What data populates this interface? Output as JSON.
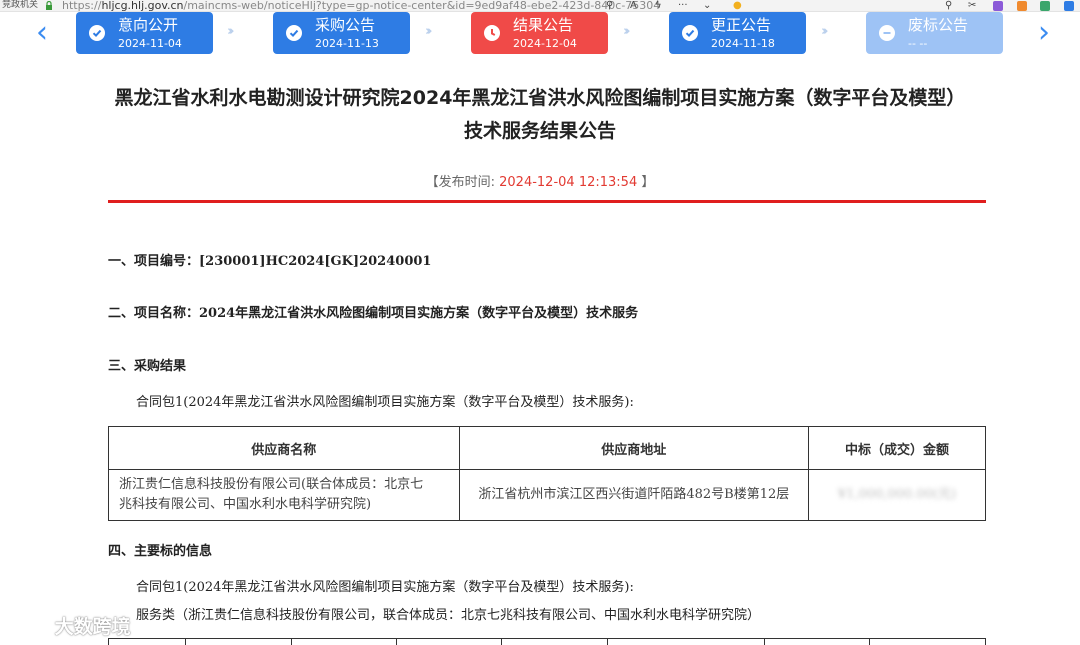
{
  "browser": {
    "site_tag": "竞政机关",
    "url_scheme": "https://",
    "url_host": "hljcg.hlj.gov.cn",
    "url_path": "/maincms-web/noticeHlj?type=gp-notice-center&id=9ed9af48-ebe2-423d-840c-75304"
  },
  "steps": [
    {
      "name": "意向公开",
      "date": "2024-11-04",
      "state": "done",
      "icon": "check-circle-icon"
    },
    {
      "name": "采购公告",
      "date": "2024-11-13",
      "state": "done",
      "icon": "check-circle-icon"
    },
    {
      "name": "结果公告",
      "date": "2024-12-04",
      "state": "current",
      "icon": "clock-icon"
    },
    {
      "name": "更正公告",
      "date": "2024-11-18",
      "state": "done",
      "icon": "check-circle-icon"
    },
    {
      "name": "废标公告",
      "date": "-- --",
      "state": "disabled",
      "icon": "minus-circle-icon"
    }
  ],
  "colors": {
    "done": "#2e7ce4",
    "current": "#f04a48",
    "disabled": "#9ec3f5",
    "accent_red": "#e01e1e"
  },
  "title": {
    "line1": "黑龙江省水利水电勘测设计研究院2024年黑龙江省洪水风险图编制项目实施方案（数字平台及模型）",
    "line2": "技术服务结果公告"
  },
  "publish": {
    "label_open": "【发布时间:",
    "time": "2024-12-04 12:13:54",
    "label_close": "】"
  },
  "sections": {
    "s1": "一、项目编号：[230001]HC2024[GK]20240001",
    "s2": "二、项目名称：2024年黑龙江省洪水风险图编制项目实施方案（数字平台及模型）技术服务",
    "s3": "三、采购结果",
    "s3_pkg": "合同包1(2024年黑龙江省洪水风险图编制项目实施方案（数字平台及模型）技术服务):",
    "s4": "四、主要标的信息",
    "s4_pkg": "合同包1(2024年黑龙江省洪水风险图编制项目实施方案（数字平台及模型）技术服务):",
    "s4_type": "服务类（浙江贵仁信息科技股份有限公司，联合体成员：北京七兆科技有限公司、中国水利水电科学研究院）"
  },
  "result_table": {
    "headers": [
      "供应商名称",
      "供应商地址",
      "中标（成交）金额"
    ],
    "rows": [
      {
        "name_line1": "浙江贵仁信息科技股份有限公司(联合体成员：北京七",
        "name_line2": "兆科技有限公司、中国水利水电科学研究院)",
        "address": "浙江省杭州市滨江区西兴街道阡陌路482号B楼第12层",
        "amount": "¥1,000,000.00(元)"
      }
    ]
  },
  "watermark": "大数跨境"
}
